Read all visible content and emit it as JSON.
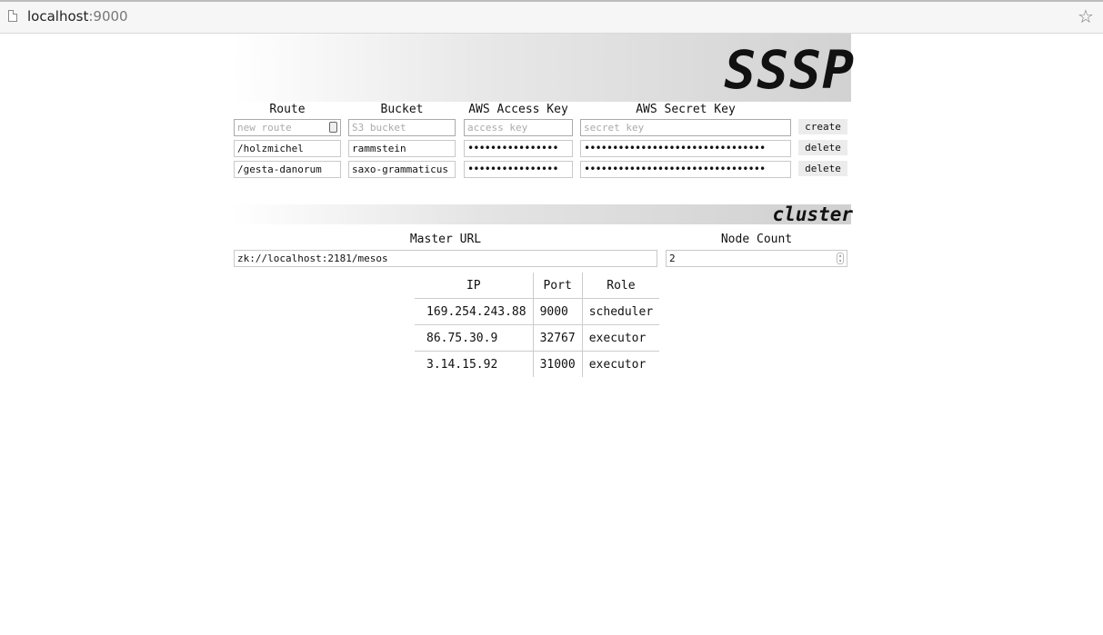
{
  "browser": {
    "url_host": "localhost",
    "url_port": ":9000"
  },
  "app": {
    "title": "SSSP"
  },
  "routes": {
    "headers": [
      "Route",
      "Bucket",
      "AWS Access Key",
      "AWS Secret Key"
    ],
    "new_row": {
      "route_placeholder": "new route",
      "bucket_placeholder": "S3 bucket",
      "access_placeholder": "access key",
      "secret_placeholder": "secret key",
      "create_label": "create"
    },
    "rows": [
      {
        "route": "/holzmichel",
        "bucket": "rammstein",
        "access_key": "••••••••••••••••",
        "secret_key": "••••••••••••••••••••••••••••••••",
        "delete_label": "delete"
      },
      {
        "route": "/gesta-danorum",
        "bucket": "saxo-grammaticus",
        "access_key": "••••••••••••••••",
        "secret_key": "••••••••••••••••••••••••••••••••",
        "delete_label": "delete"
      }
    ]
  },
  "cluster": {
    "title": "cluster",
    "master_url_label": "Master URL",
    "master_url": "zk://localhost:2181/mesos",
    "node_count_label": "Node Count",
    "node_count": "2",
    "nodes_headers": [
      "IP",
      "Port",
      "Role"
    ],
    "nodes": [
      {
        "ip": "169.254.243.88",
        "port": "9000",
        "role": "scheduler"
      },
      {
        "ip": "86.75.30.9",
        "port": "32767",
        "role": "executor"
      },
      {
        "ip": "3.14.15.92",
        "port": "31000",
        "role": "executor"
      }
    ]
  }
}
